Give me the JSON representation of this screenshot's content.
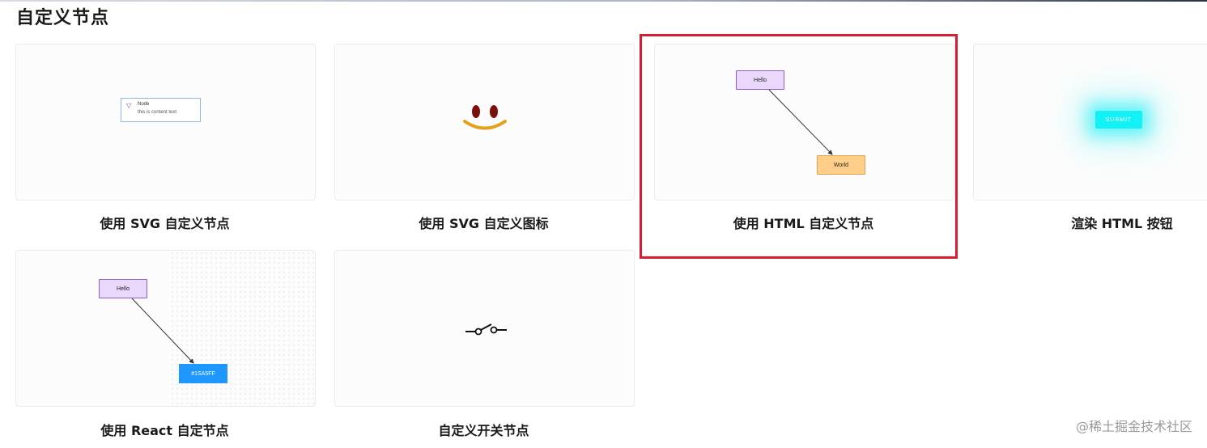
{
  "page": {
    "title": "自定义节点",
    "watermark": "@稀土掘金技术社区"
  },
  "cards": [
    {
      "caption": "使用 SVG 自定义节点",
      "node_title": "Node",
      "node_text": "this is content text"
    },
    {
      "caption": "使用 SVG 自定义图标"
    },
    {
      "caption": "使用 HTML 自定义节点",
      "node_a": "Hello",
      "node_b": "World"
    },
    {
      "caption": "渲染 HTML 按钮",
      "button": "SUBMIT"
    },
    {
      "caption": "使用 React 自定节点",
      "node_a": "Hello",
      "node_b": "#1SA5FF"
    },
    {
      "caption": "自定义开关节点"
    }
  ],
  "colors": {
    "highlight": "#d71d33",
    "purple_node": "#e9d8fb",
    "orange_node": "#ffcf8a",
    "cyan_button": "#12f1f5",
    "blue_node": "#1e98ff",
    "smile_eyes": "#7a0f0c",
    "smile_mouth": "#e2a21a"
  }
}
